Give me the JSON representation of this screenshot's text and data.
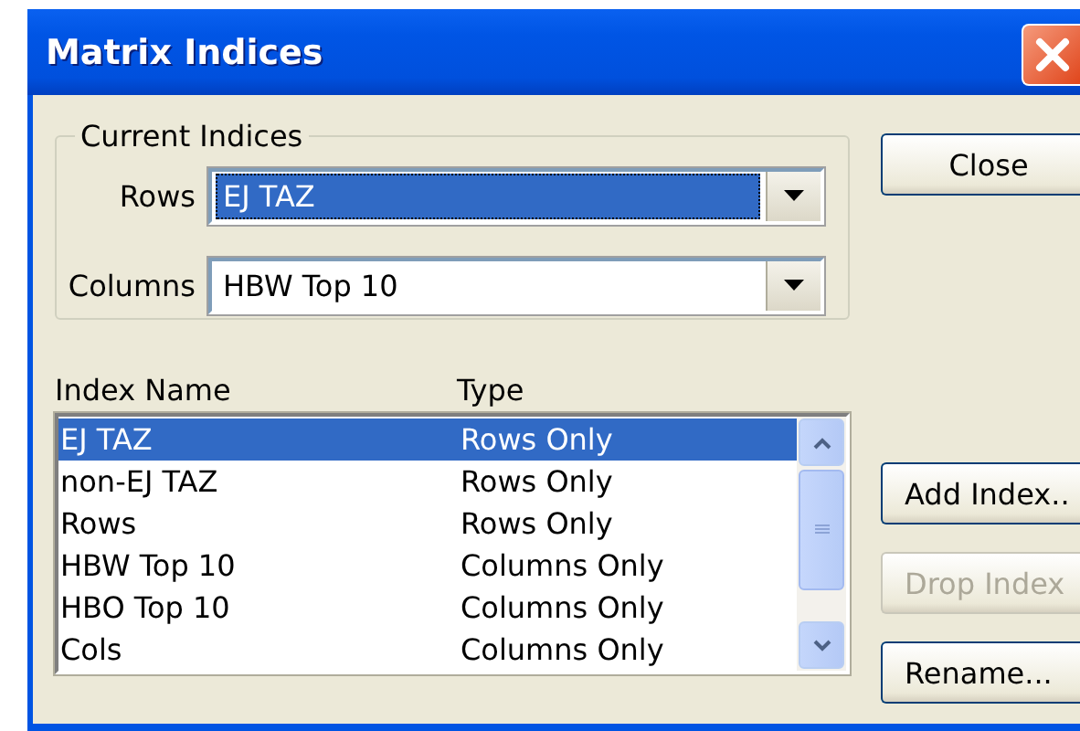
{
  "window": {
    "title": "Matrix Indices"
  },
  "current_indices": {
    "label": "Current Indices",
    "fields": [
      {
        "label": "Rows",
        "value": "EJ TAZ",
        "focused": true
      },
      {
        "label": "Columns",
        "value": "HBW Top 10",
        "focused": false
      }
    ]
  },
  "close_button": {
    "label": "Close",
    "disabled": false
  },
  "list": {
    "columns": [
      "Index Name",
      "Type"
    ],
    "rows": [
      {
        "name": "EJ TAZ",
        "type": "Rows Only",
        "selected": true
      },
      {
        "name": "non-EJ TAZ",
        "type": "Rows Only",
        "selected": false
      },
      {
        "name": "Rows",
        "type": "Rows Only",
        "selected": false
      },
      {
        "name": "HBW Top 10",
        "type": "Columns Only",
        "selected": false
      },
      {
        "name": "HBO Top 10",
        "type": "Columns Only",
        "selected": false
      },
      {
        "name": "Cols",
        "type": "Columns Only",
        "selected": false
      }
    ]
  },
  "side_buttons": [
    {
      "label": "Add Index..",
      "disabled": false
    },
    {
      "label": "Drop Index",
      "disabled": true
    },
    {
      "label": "Rename...",
      "disabled": false
    }
  ]
}
